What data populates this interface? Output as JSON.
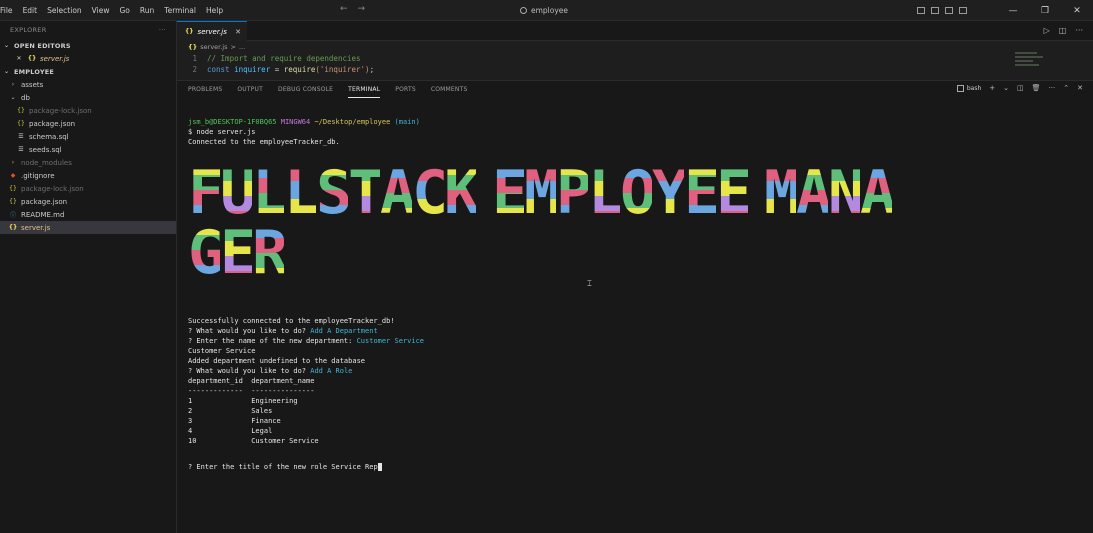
{
  "titlebar": {
    "menu": [
      "File",
      "Edit",
      "Selection",
      "View",
      "Go",
      "Run",
      "Terminal",
      "Help"
    ],
    "search": "employee"
  },
  "sidebar": {
    "header": "EXPLORER",
    "open_editors_label": "OPEN EDITORS",
    "open_editors": [
      {
        "name": "server.js"
      }
    ],
    "project_label": "EMPLOYEE",
    "tree": [
      {
        "name": "assets",
        "type": "folder"
      },
      {
        "name": "db",
        "type": "folder-open"
      },
      {
        "name": "package-lock.json",
        "type": "json",
        "dim": true
      },
      {
        "name": "package.json",
        "type": "json"
      },
      {
        "name": "schema.sql",
        "type": "sql"
      },
      {
        "name": "seeds.sql",
        "type": "sql"
      },
      {
        "name": "node_modules",
        "type": "folder",
        "dim": true
      },
      {
        "name": ".gitignore",
        "type": "git"
      },
      {
        "name": "package-lock.json",
        "type": "json",
        "dim": true
      },
      {
        "name": "package.json",
        "type": "json"
      },
      {
        "name": "README.md",
        "type": "md"
      },
      {
        "name": "server.js",
        "type": "js",
        "active": true
      }
    ]
  },
  "editor": {
    "tab": "server.js",
    "breadcrumb": [
      "server.js",
      ">",
      "..."
    ],
    "lines": [
      {
        "n": "1",
        "comment": "// Import and require dependencies"
      },
      {
        "n": "2",
        "kw": "const",
        "var": "inquirer",
        "eq": "=",
        "fn": "require",
        "str": "('inquirer')",
        "end": ";"
      }
    ]
  },
  "panel": {
    "tabs": [
      "PROBLEMS",
      "OUTPUT",
      "DEBUG CONSOLE",
      "TERMINAL",
      "PORTS",
      "COMMENTS"
    ],
    "active_tab": "TERMINAL",
    "shell": "bash"
  },
  "terminal": {
    "prompt_user": "jsm_b@DESKTOP-1F0BQ65",
    "prompt_env": "MINGW64",
    "prompt_path": "~/Desktop/employee",
    "prompt_branch": "(main)",
    "cmd": "$ node server.js",
    "connected": "Connected to the employeeTracker_db.",
    "banner_line1": "FULLSTACK EMPLOYEE MANA",
    "banner_line2": "GER",
    "lines_after": [
      {
        "text": "Successfully connected to the employeeTracker_db!"
      },
      {
        "q": "? What would you like to do?",
        "a": "Add A Department"
      },
      {
        "q": "? Enter the name of the new department:",
        "a": "Customer Service"
      },
      {
        "text": "Customer Service"
      },
      {
        "text": "Added department undefined to the database"
      },
      {
        "q": "? What would you like to do?",
        "a": "Add A Role"
      },
      {
        "text": "department_id  department_name"
      },
      {
        "text": "-------------  ---------------"
      },
      {
        "text": "1              Engineering"
      },
      {
        "text": "2              Sales"
      },
      {
        "text": "3              Finance"
      },
      {
        "text": "4              Legal"
      },
      {
        "text": "10             Customer Service"
      },
      {
        "text": ""
      },
      {
        "q": "? Enter the title of the new role",
        "a": "Service Rep"
      }
    ]
  }
}
